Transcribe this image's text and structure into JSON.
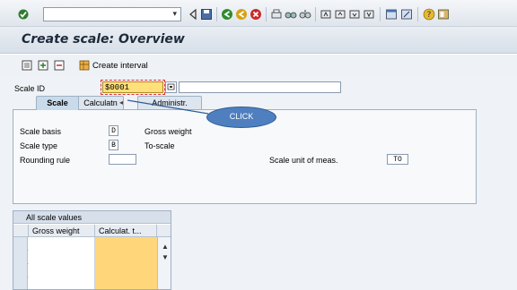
{
  "toolbar": {
    "command_field_value": "",
    "dropdown_arrow": "▾"
  },
  "title": "Create scale: Overview",
  "app_toolbar": {
    "create_interval": "Create interval"
  },
  "header": {
    "scale_id_label": "Scale ID",
    "scale_id_value": "$0001",
    "description_value": ""
  },
  "tabs": [
    {
      "label": "Scale",
      "active": true
    },
    {
      "label": "Calculatn",
      "active": false
    },
    {
      "label": "Administr.",
      "active": false
    }
  ],
  "callout": "CLICK",
  "scale_panel": {
    "scale_basis_label": "Scale basis",
    "scale_basis_value": "D",
    "scale_basis_text": "Gross weight",
    "scale_type_label": "Scale type",
    "scale_type_value": "B",
    "scale_type_text": "To-scale",
    "rounding_rule_label": "Rounding rule",
    "rounding_rule_value": "",
    "unit_label": "Scale unit of meas.",
    "unit_value": "TO"
  },
  "table": {
    "title": "All scale values",
    "columns": [
      "Gross weight",
      "Calculat. t..."
    ],
    "rows": [
      [
        "",
        ""
      ],
      [
        "",
        ""
      ],
      [
        "",
        ""
      ],
      [
        "",
        ""
      ]
    ]
  },
  "colors": {
    "accent": "#4f7fbf",
    "required_field": "#ffd77a"
  }
}
